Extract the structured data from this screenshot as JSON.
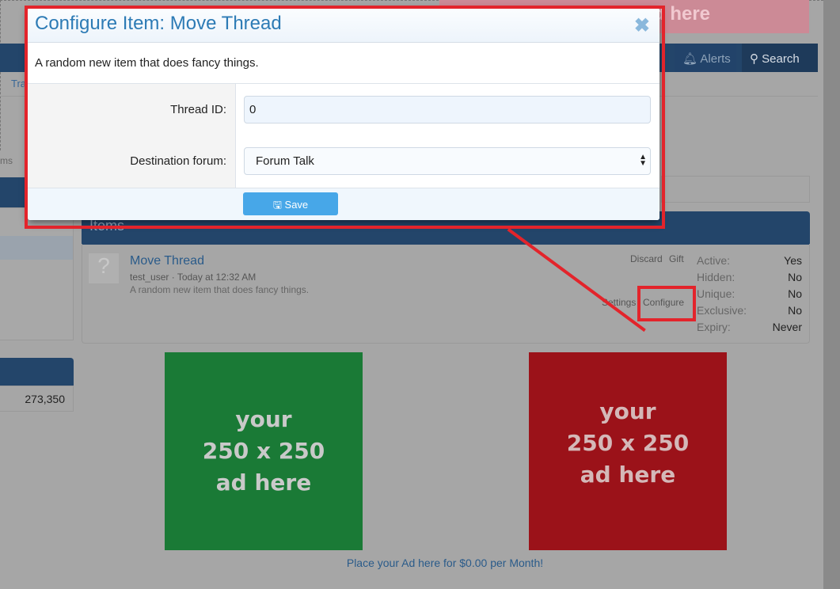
{
  "background": {
    "top_ad_text": "d here",
    "nav": {
      "alerts": "Alerts",
      "search": "Search"
    },
    "breadcrumb": "Tra",
    "left_text": "ms",
    "left_number": "273,350"
  },
  "items_panel": {
    "title": "Items",
    "item": {
      "name": "Move Thread",
      "user": "test_user",
      "date": "Today at 12:32 AM",
      "description": "A random new item that does fancy things.",
      "links": {
        "discard": "Discard",
        "gift": "Gift",
        "settings": "Settings",
        "configure": "Configure"
      },
      "stats": [
        {
          "k": "Active:",
          "v": "Yes"
        },
        {
          "k": "Hidden:",
          "v": "No"
        },
        {
          "k": "Unique:",
          "v": "No"
        },
        {
          "k": "Exclusive:",
          "v": "No"
        },
        {
          "k": "Expiry:",
          "v": "Never"
        }
      ]
    }
  },
  "ads": {
    "green": {
      "l1": "your",
      "l2": "250 x 250",
      "l3": "ad here",
      "color": "#1a7a36"
    },
    "red": {
      "l1": "your",
      "l2": "250 x 250",
      "l3": "ad here",
      "color": "#9b1219"
    },
    "link": "Place your Ad here for $0.00 per Month!"
  },
  "modal": {
    "title": "Configure Item: Move Thread",
    "close": "✖",
    "description": "A random new item that does fancy things.",
    "thread_id_label": "Thread ID:",
    "thread_id_value": "0",
    "destination_label": "Destination forum:",
    "destination_value": "Forum Talk",
    "save": "Save"
  },
  "colors": {
    "highlight": "#e3242b",
    "accent": "#2d7bb5",
    "nav": "#23456a"
  }
}
